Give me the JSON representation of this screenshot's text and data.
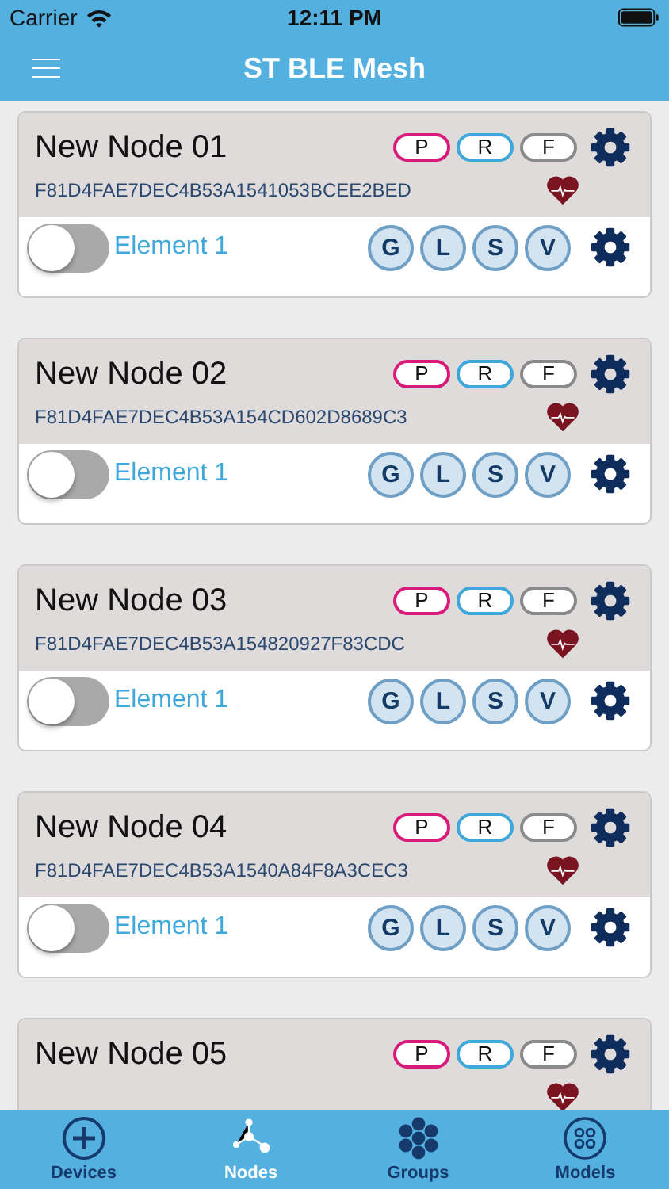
{
  "status_bar": {
    "carrier": "Carrier",
    "time": "12:11 PM"
  },
  "nav": {
    "title": "ST BLE Mesh"
  },
  "nodes": [
    {
      "name": "New Node 01",
      "address": "F81D4FAE7DEC4B53A1541053BCEE2BED",
      "badges": [
        {
          "label": "P",
          "color": "#d81b7a"
        },
        {
          "label": "R",
          "color": "#3ea8dc"
        },
        {
          "label": "F",
          "color": "#8a8a8a"
        }
      ],
      "elements": [
        {
          "label": "Element 1",
          "on": false,
          "models": [
            "G",
            "L",
            "S",
            "V"
          ]
        }
      ]
    },
    {
      "name": "New Node 02",
      "address": "F81D4FAE7DEC4B53A154CD602D8689C3",
      "badges": [
        {
          "label": "P",
          "color": "#d81b7a"
        },
        {
          "label": "R",
          "color": "#3ea8dc"
        },
        {
          "label": "F",
          "color": "#8a8a8a"
        }
      ],
      "elements": [
        {
          "label": "Element 1",
          "on": false,
          "models": [
            "G",
            "L",
            "S",
            "V"
          ]
        }
      ]
    },
    {
      "name": "New Node 03",
      "address": "F81D4FAE7DEC4B53A154820927F83CDC",
      "badges": [
        {
          "label": "P",
          "color": "#d81b7a"
        },
        {
          "label": "R",
          "color": "#3ea8dc"
        },
        {
          "label": "F",
          "color": "#8a8a8a"
        }
      ],
      "elements": [
        {
          "label": "Element 1",
          "on": false,
          "models": [
            "G",
            "L",
            "S",
            "V"
          ]
        }
      ]
    },
    {
      "name": "New Node 04",
      "address": "F81D4FAE7DEC4B53A1540A84F8A3CEC3",
      "badges": [
        {
          "label": "P",
          "color": "#d81b7a"
        },
        {
          "label": "R",
          "color": "#3ea8dc"
        },
        {
          "label": "F",
          "color": "#8a8a8a"
        }
      ],
      "elements": [
        {
          "label": "Element 1",
          "on": false,
          "models": [
            "G",
            "L",
            "S",
            "V"
          ]
        }
      ]
    },
    {
      "name": "New Node 05",
      "badges": [
        {
          "label": "P",
          "color": "#d81b7a"
        },
        {
          "label": "R",
          "color": "#3ea8dc"
        },
        {
          "label": "F",
          "color": "#8a8a8a"
        }
      ]
    }
  ],
  "tabs": [
    {
      "label": "Devices",
      "kind": "add",
      "selected": false
    },
    {
      "label": "Nodes",
      "kind": "nodes",
      "selected": true
    },
    {
      "label": "Groups",
      "kind": "groups",
      "selected": false
    },
    {
      "label": "Models",
      "kind": "models",
      "selected": false
    }
  ]
}
